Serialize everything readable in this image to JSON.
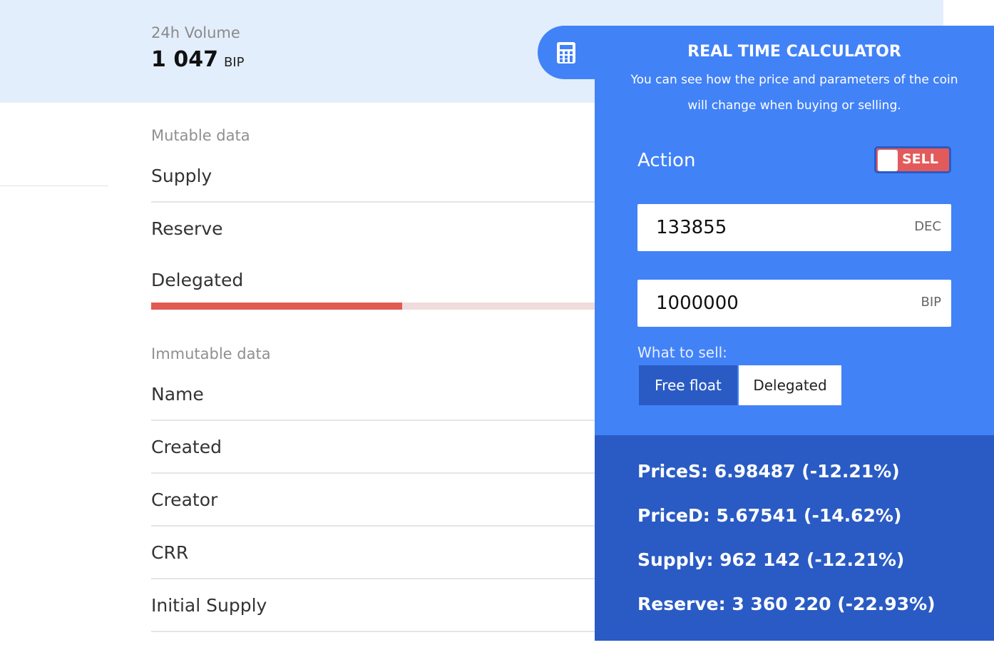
{
  "volume": {
    "label": "24h Volume",
    "value": "1 047",
    "unit": "BIP"
  },
  "mutable": {
    "section_label": "Mutable data",
    "rows": [
      "Supply",
      "Reserve",
      "Delegated"
    ],
    "delegated_progress_percent": 55
  },
  "immutable": {
    "section_label": "Immutable data",
    "rows": [
      "Name",
      "Created",
      "Creator",
      "CRR",
      "Initial Supply"
    ]
  },
  "calculator": {
    "toggle_icon": "calculator-icon",
    "title": "REAL TIME CALCULATOR",
    "description": "You can see how the price and parameters of the coin will change when buying or selling.",
    "action_label": "Action",
    "action_value": "SELL",
    "amount_field": {
      "value": "133855",
      "unit": "DEC"
    },
    "bip_field": {
      "value": "1000000",
      "unit": "BIP"
    },
    "what_to_sell_label": "What to sell:",
    "options": [
      "Free float",
      "Delegated"
    ],
    "selected_option": "Free float"
  },
  "results": [
    "PriceS: 6.98487 (-12.21%)",
    "PriceD: 5.67541 (-14.62%)",
    "Supply: 962 142 (-12.21%)",
    "Reserve: 3 360 220 (-22.93%)"
  ],
  "colors": {
    "panel_blue": "#4282f7",
    "results_blue": "#2a5bc4",
    "sell_red": "#e35a5a",
    "progress_red": "#e05b52",
    "top_band": "#e3eefd"
  }
}
